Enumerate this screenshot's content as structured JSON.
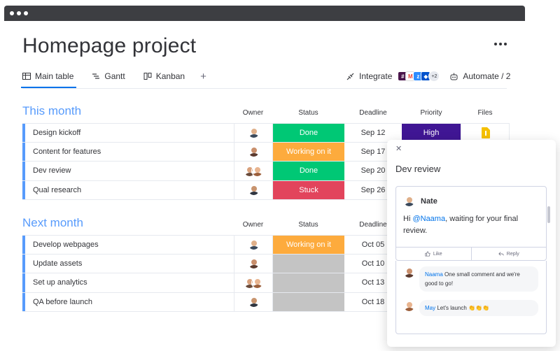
{
  "window": {
    "dots": 3
  },
  "header": {
    "title": "Homepage project"
  },
  "tabs": [
    {
      "label": "Main table",
      "icon": "table-icon"
    },
    {
      "label": "Gantt",
      "icon": "gantt-icon"
    },
    {
      "label": "Kanban",
      "icon": "kanban-icon"
    }
  ],
  "toolbar": {
    "integrate_label": "Integrate",
    "integrations_more": "+2",
    "automate_label": "Automate / 2"
  },
  "columns": {
    "owner": "Owner",
    "status": "Status",
    "deadline": "Deadline",
    "priority": "Priority",
    "files": "Files"
  },
  "groups": [
    {
      "title": "This month",
      "rows": [
        {
          "name": "Design kickoff",
          "status": "Done",
          "status_color": "#00c875",
          "deadline": "Sep 12",
          "priority": "High",
          "priority_color": "#401694"
        },
        {
          "name": "Content for features",
          "status": "Working on it",
          "status_color": "#fdab3d",
          "deadline": "Sep 17"
        },
        {
          "name": "Dev review",
          "status": "Done",
          "status_color": "#00c875",
          "deadline": "Sep 20"
        },
        {
          "name": "Qual research",
          "status": "Stuck",
          "status_color": "#e2445c",
          "deadline": "Sep 26"
        }
      ]
    },
    {
      "title": "Next month",
      "rows": [
        {
          "name": "Develop webpages",
          "status": "Working on it",
          "status_color": "#fdab3d",
          "deadline": "Oct  05"
        },
        {
          "name": "Update assets",
          "status": "",
          "status_color": "#c4c4c4",
          "deadline": "Oct 10"
        },
        {
          "name": "Set up analytics",
          "status": "",
          "status_color": "#c4c4c4",
          "deadline": "Oct 13"
        },
        {
          "name": "QA before launch",
          "status": "",
          "status_color": "#c4c4c4",
          "deadline": "Oct 18"
        }
      ]
    }
  ],
  "panel": {
    "title": "Dev review",
    "update": {
      "author": "Nate",
      "mention": "@Naama",
      "text_before": "Hi ",
      "text_after": ", waiting for your final review.",
      "like_label": "Like",
      "reply_label": "Reply"
    },
    "replies": [
      {
        "name": "Naama",
        "text": "One small comment and we're good to go!"
      },
      {
        "name": "May",
        "text": "Let's launch 👏👏👏"
      }
    ]
  },
  "colors": {
    "accent": "#0073ea",
    "group": "#579bfc",
    "done": "#00c875",
    "working": "#fdab3d",
    "stuck": "#e2445c",
    "empty": "#c4c4c4",
    "high": "#401694"
  }
}
